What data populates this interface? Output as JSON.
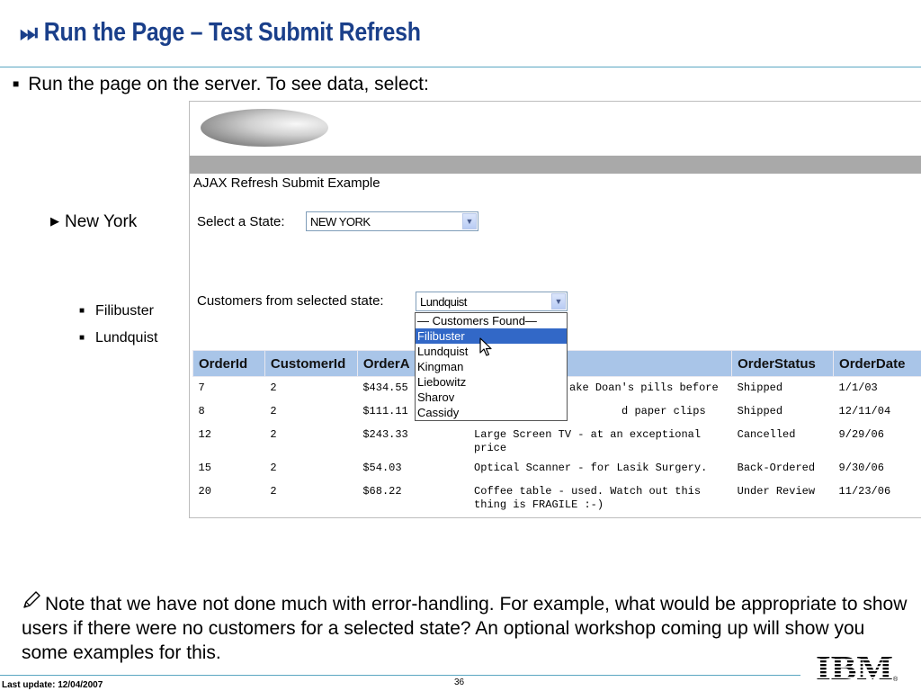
{
  "slide": {
    "title_icon": "⏭",
    "title": "Run the Page – Test Submit Refresh",
    "bullet": "Run the page on the server.  To see data, select:",
    "state_choice": "New York",
    "customers": [
      "Filibuster",
      "Lundquist"
    ],
    "note": "Note that we have not done much with error-handling.  For example, what would be appropriate to show users if there were no customers for a selected state?  An optional workshop coming up will show you some examples for this.",
    "footer_left": "Last update: 12/04/2007",
    "page_number": "36",
    "logo_text": "IBM"
  },
  "app": {
    "title": "AJAX Refresh Submit Example",
    "state_label": "Select a State:",
    "state_value": "NEW YORK",
    "customers_label": "Customers from selected state:",
    "customer_value": "Lundquist",
    "dropdown_options": [
      "— Customers Found—",
      "Filibuster",
      "Lundquist",
      "Kingman",
      "Liebowitz",
      "Sharov",
      "Cassidy"
    ],
    "dropdown_highlighted": "Filibuster",
    "table": {
      "columns": [
        "OrderId",
        "CustomerId",
        "OrderA",
        "",
        "OrderStatus",
        "OrderDate"
      ],
      "rows": [
        {
          "id": "7",
          "cust": "2",
          "amt": "$434.55",
          "desc": "ake Doan's pills before",
          "status": "Shipped",
          "date": "1/1/03"
        },
        {
          "id": "8",
          "cust": "2",
          "amt": "$111.11",
          "desc": "d paper clips",
          "status": "Shipped",
          "date": "12/11/04"
        },
        {
          "id": "12",
          "cust": "2",
          "amt": "$243.33",
          "desc": "Large Screen TV - at an exceptional price",
          "status": "Cancelled",
          "date": "9/29/06"
        },
        {
          "id": "15",
          "cust": "2",
          "amt": "$54.03",
          "desc": "Optical Scanner - for Lasik Surgery.",
          "status": "Back-Ordered",
          "date": "9/30/06"
        },
        {
          "id": "20",
          "cust": "2",
          "amt": "$68.22",
          "desc": "Coffee table - used. Watch out this thing is FRAGILE :-)",
          "status": "Under Review",
          "date": "11/23/06"
        }
      ]
    }
  },
  "icons": {
    "title": "skip-forward-icon",
    "pencil": "pencil-icon",
    "cursor": "mouse-pointer-icon",
    "dropdown_arrow": "chevron-down-icon"
  },
  "colors": {
    "title": "#1a3f8a",
    "rule": "#5aa6c2",
    "table_header": "#a9c5e8",
    "selection": "#3268c7"
  }
}
